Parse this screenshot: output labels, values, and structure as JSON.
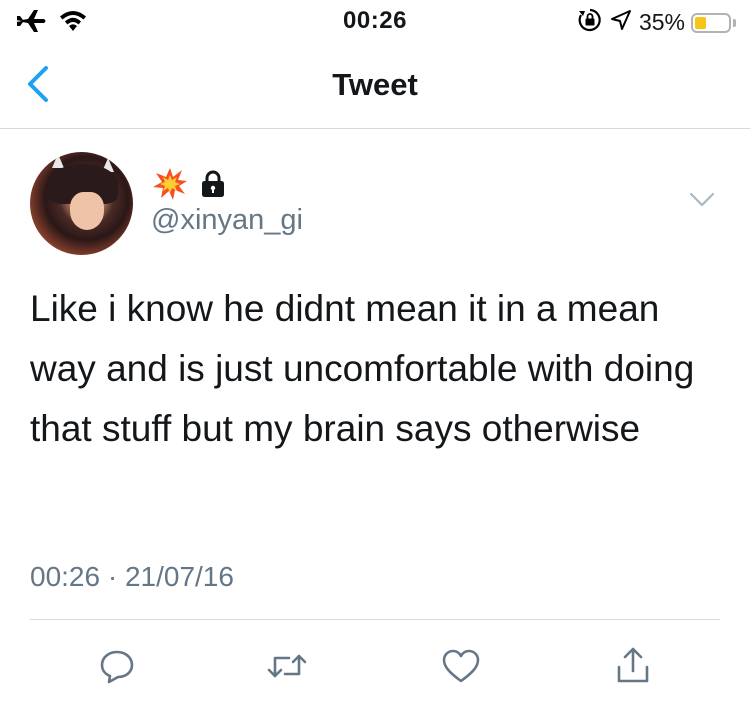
{
  "status_bar": {
    "time": "00:26",
    "battery_percent_label": "35%",
    "battery_level": 0.35,
    "battery_color": "#f5c518",
    "icons": [
      "airplane-icon",
      "wifi-icon",
      "rotation-lock-icon",
      "location-arrow-icon",
      "battery-icon"
    ]
  },
  "nav": {
    "title": "Tweet",
    "back_icon": "chevron-left-icon",
    "accent": "#1da1f2"
  },
  "tweet": {
    "name_icons": [
      "collision-emoji-icon",
      "lock-icon"
    ],
    "handle": "@xinyan_gi",
    "text": "Like i know he didnt mean it in a mean way and is just uncomfortable with doing that stuff but my brain says otherwise",
    "timestamp": "00:26 · 21/07/16",
    "menu_icon": "chevron-down-icon"
  },
  "actions": [
    {
      "name": "reply",
      "icon": "comment-icon"
    },
    {
      "name": "retweet",
      "icon": "retweet-icon"
    },
    {
      "name": "like",
      "icon": "heart-icon"
    },
    {
      "name": "share",
      "icon": "share-icon"
    }
  ]
}
